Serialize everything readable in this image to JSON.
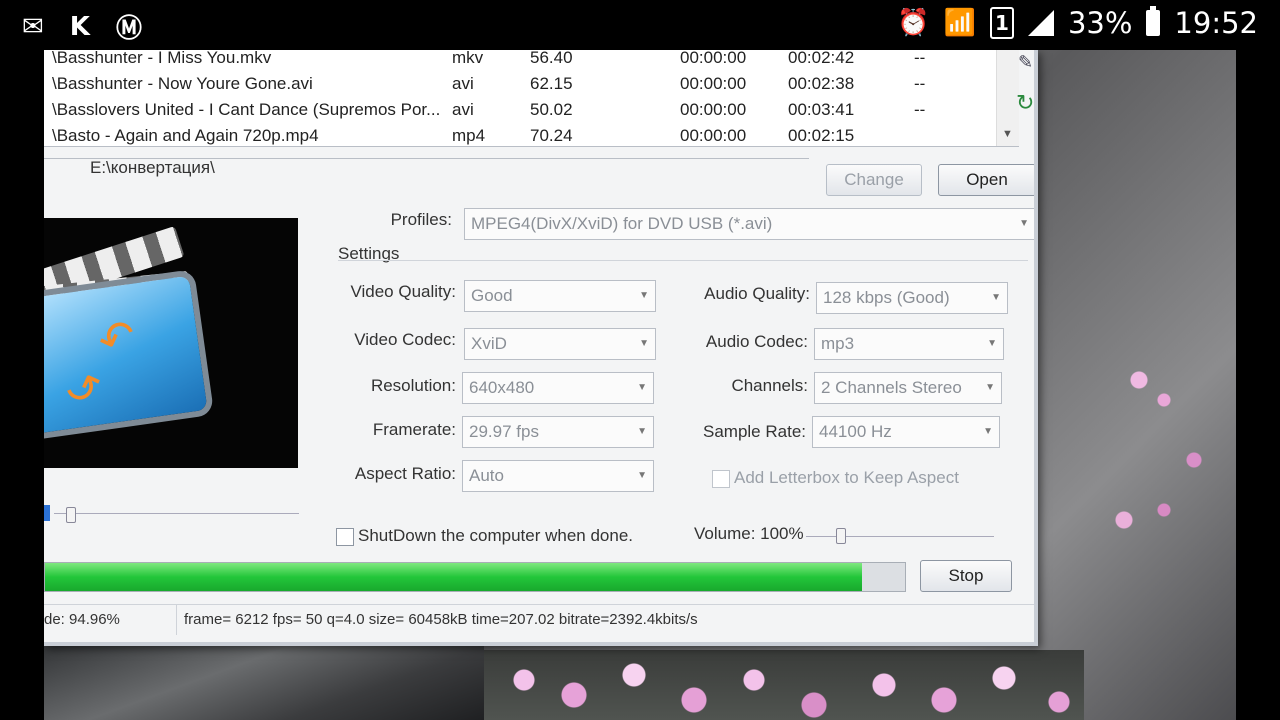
{
  "status_bar": {
    "left_icons": [
      "mail-icon",
      "k-app-icon",
      "metro-icon"
    ],
    "battery": "33%",
    "time": "19:52",
    "sim_label": "1"
  },
  "file_list": {
    "rows": [
      {
        "name": "\\Basshunter - I Miss You.mkv",
        "ext": "mkv",
        "size": "56.40",
        "start": "00:00:00",
        "duration": "00:02:42",
        "status": "--"
      },
      {
        "name": "\\Basshunter - Now Youre Gone.avi",
        "ext": "avi",
        "size": "62.15",
        "start": "00:00:00",
        "duration": "00:02:38",
        "status": "--"
      },
      {
        "name": "\\Basslovers United - I Cant Dance (Supremos Por...",
        "ext": "avi",
        "size": "50.02",
        "start": "00:00:00",
        "duration": "00:03:41",
        "status": "--"
      },
      {
        "name": "\\Basto - Again and Again 720p.mp4",
        "ext": "mp4",
        "size": "70.24",
        "start": "00:00:00",
        "duration": "00:02:15",
        "status": ""
      }
    ]
  },
  "output": {
    "path": "E:\\конвертация\\",
    "change_label": "Change",
    "open_label": "Open"
  },
  "settings": {
    "profiles_label": "Profiles:",
    "profile_value": "MPEG4(DivX/XviD) for DVD USB (*.avi)",
    "group_title": "Settings",
    "video_quality_label": "Video Quality:",
    "video_quality": "Good",
    "video_codec_label": "Video Codec:",
    "video_codec": "XviD",
    "resolution_label": "Resolution:",
    "resolution": "640x480",
    "framerate_label": "Framerate:",
    "framerate": "29.97  fps",
    "aspect_ratio_label": "Aspect Ratio:",
    "aspect_ratio": "Auto",
    "audio_quality_label": "Audio Quality:",
    "audio_quality": "128 kbps (Good)",
    "audio_codec_label": "Audio Codec:",
    "audio_codec": "mp3",
    "channels_label": "Channels:",
    "channels": "2 Channels Stereo",
    "sample_rate_label": "Sample Rate:",
    "sample_rate": "44100 Hz",
    "letterbox_label": "Add Letterbox to Keep Aspect",
    "shutdown_label": "ShutDown the computer when done.",
    "volume_label": "Volume: 100%"
  },
  "progress": {
    "fraction": 0.9496,
    "stop_label": "Stop",
    "done_text": "de: 94.96%",
    "ffmpeg_text": "frame= 6212 fps= 50 q=4.0 size=   60458kB time=207.02 bitrate=2392.4kbits/s"
  },
  "colors": {
    "progress_green": "#23c63a",
    "window_bg": "#f3f4f5",
    "accent_orange": "#f28c28"
  }
}
